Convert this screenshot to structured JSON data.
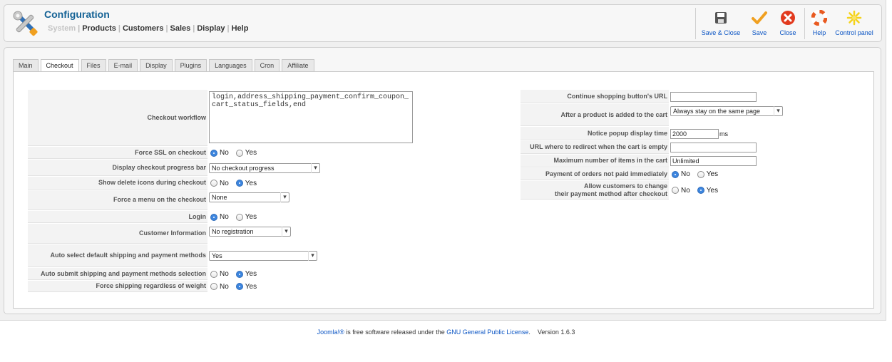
{
  "header": {
    "title": "Configuration",
    "menu": [
      {
        "label": "System",
        "disabled": true
      },
      {
        "label": "Products",
        "disabled": false
      },
      {
        "label": "Customers",
        "disabled": false
      },
      {
        "label": "Sales",
        "disabled": false
      },
      {
        "label": "Display",
        "disabled": false
      },
      {
        "label": "Help",
        "disabled": false
      }
    ]
  },
  "toolbar": {
    "save_close": "Save & Close",
    "save": "Save",
    "close": "Close",
    "help": "Help",
    "control_panel": "Control panel"
  },
  "tabs": [
    "Main",
    "Checkout",
    "Files",
    "E-mail",
    "Display",
    "Plugins",
    "Languages",
    "Cron",
    "Affiliate"
  ],
  "active_tab": "Checkout",
  "left": {
    "checkout_workflow": {
      "label": "Checkout workflow",
      "value": "login,address_shipping_payment_confirm_coupon_cart_status_fields,end"
    },
    "force_ssl": {
      "label": "Force SSL on checkout",
      "no": "No",
      "yes": "Yes",
      "selected": "No"
    },
    "progress_bar": {
      "label": "Display checkout progress bar",
      "value": "No checkout progress"
    },
    "delete_icons": {
      "label": "Show delete icons during checkout",
      "no": "No",
      "yes": "Yes",
      "selected": "Yes"
    },
    "force_menu": {
      "label": "Force a menu on the checkout",
      "value": "None"
    },
    "login": {
      "label": "Login",
      "no": "No",
      "yes": "Yes",
      "selected": "No"
    },
    "customer_info": {
      "label": "Customer Information",
      "value": "No registration"
    },
    "auto_select": {
      "label": "Auto select default shipping and payment methods",
      "value": "Yes"
    },
    "auto_submit": {
      "label": "Auto submit shipping and payment methods selection",
      "no": "No",
      "yes": "Yes",
      "selected": "Yes"
    },
    "force_shipping": {
      "label": "Force shipping regardless of weight",
      "no": "No",
      "yes": "Yes",
      "selected": "Yes"
    }
  },
  "right": {
    "continue_shopping": {
      "label": "Continue shopping button's URL",
      "value": ""
    },
    "after_add": {
      "label": "After a product is added to the cart",
      "value": "Always stay on the same page"
    },
    "popup_time": {
      "label": "Notice popup display time",
      "value": "2000",
      "unit": "ms"
    },
    "redirect_empty": {
      "label": "URL where to redirect when the cart is empty",
      "value": ""
    },
    "max_items": {
      "label": "Maximum number of items in the cart",
      "value": "Unlimited"
    },
    "payment_not_paid": {
      "label": "Payment of orders not paid immediately",
      "no": "No",
      "yes": "Yes",
      "selected": "No"
    },
    "change_payment": {
      "label_line1": "Allow customers to change",
      "label_line2": "their payment method after checkout",
      "no": "No",
      "yes": "Yes",
      "selected": "Yes"
    }
  },
  "footer": {
    "joomla": "Joomla!®",
    "text1": " is free software released under the ",
    "license": "GNU General Public License",
    "text2": ".",
    "version": "Version 1.6.3"
  }
}
